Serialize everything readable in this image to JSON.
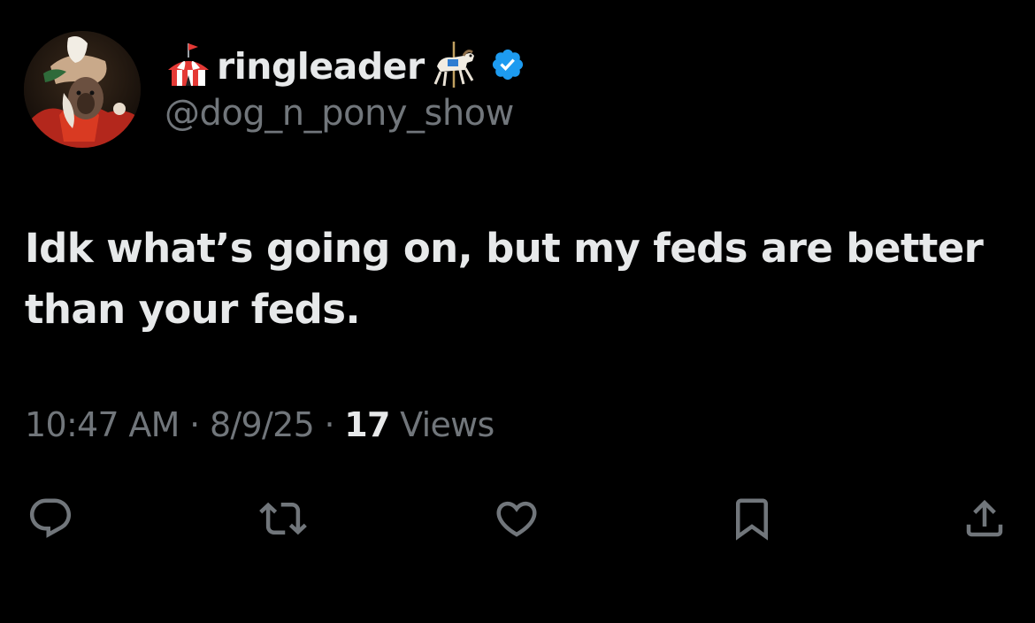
{
  "author": {
    "display_name": "ringleader",
    "handle": "@dog_n_pony_show",
    "avatar": "avatar-portrait-red-robed-figure",
    "emoji_before": "circus-tent-icon",
    "emoji_after": "carousel-horse-icon",
    "verified": true,
    "verified_color": "#1d9bf0"
  },
  "tweet": {
    "text": "Idk what’s going on, but my feds are better than your feds."
  },
  "meta": {
    "time": "10:47 AM",
    "separator": "·",
    "date": "8/9/25",
    "views_count": "17",
    "views_label": "Views"
  },
  "actions": [
    {
      "name": "reply",
      "icon": "reply-icon"
    },
    {
      "name": "retweet",
      "icon": "retweet-icon"
    },
    {
      "name": "like",
      "icon": "heart-icon"
    },
    {
      "name": "bookmark",
      "icon": "bookmark-icon"
    },
    {
      "name": "share",
      "icon": "share-icon"
    }
  ],
  "colors": {
    "background": "#000000",
    "text": "#e7e9ea",
    "secondary": "#71767b"
  }
}
